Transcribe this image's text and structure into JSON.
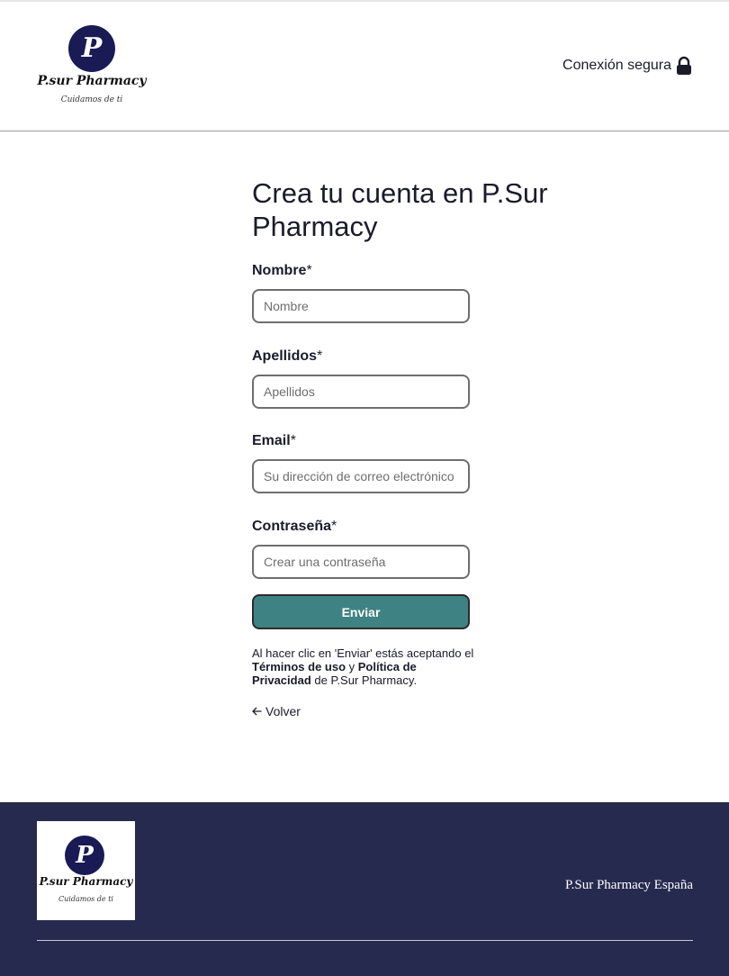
{
  "header": {
    "brand_name": "P.sur Pharmacy",
    "brand_tagline": "Cuidamos de ti",
    "logo_letter": "P",
    "secure_label": "Conexión segura",
    "secure_icon": "lock-icon"
  },
  "form": {
    "title": "Crea tu cuenta en P.Sur Pharmacy",
    "fields": [
      {
        "label": "Nombre",
        "required": "*",
        "placeholder": "Nombre",
        "value": ""
      },
      {
        "label": "Apellidos",
        "required": "*",
        "placeholder": "Apellidos",
        "value": ""
      },
      {
        "label": "Email",
        "required": "*",
        "placeholder": "Su dirección de correo electrónico",
        "value": ""
      },
      {
        "label": "Contraseña",
        "required": "*",
        "placeholder": "Crear una contraseña",
        "value": ""
      }
    ],
    "submit_label": "Enviar",
    "terms": {
      "prefix": "Al hacer clic en 'Enviar' estás aceptando el ",
      "terms_link": "Términos de uso",
      "conjunction": " y ",
      "privacy_link": "Política de Privacidad",
      "suffix": " de P.Sur Pharmacy."
    },
    "back_label": "Volver",
    "back_icon": "arrow-left-icon"
  },
  "footer": {
    "brand_name": "P.sur Pharmacy",
    "brand_tagline": "Cuidamos de ti",
    "logo_letter": "P",
    "company": "P.Sur Pharmacy España"
  },
  "colors": {
    "brand_navy": "#1a1a55",
    "button_teal": "#3f8283",
    "footer_bg": "#272a4f"
  }
}
